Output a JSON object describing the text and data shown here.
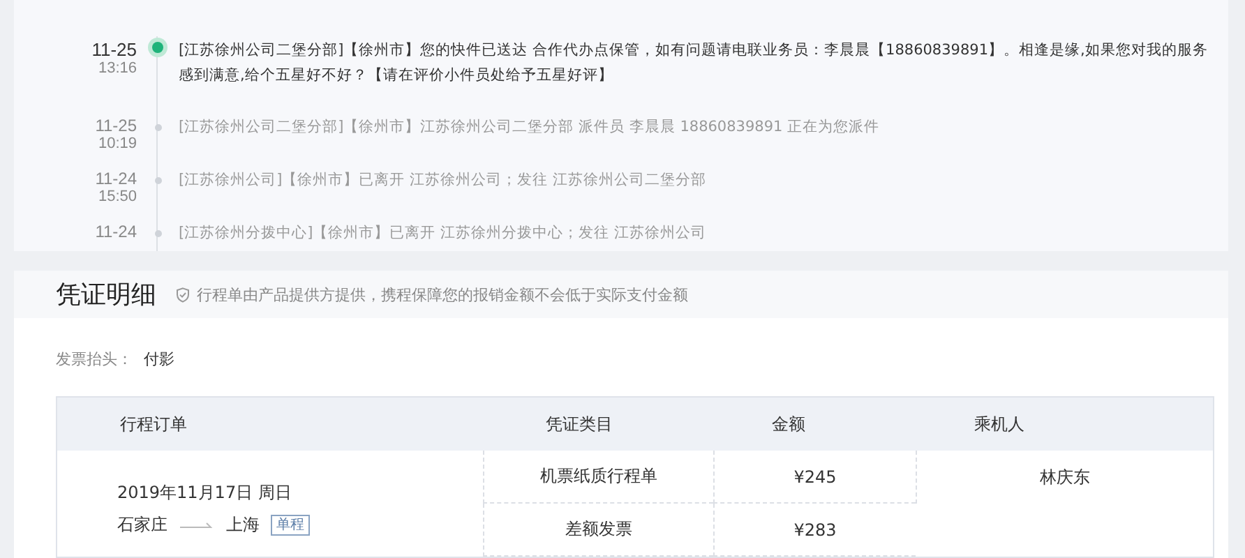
{
  "tracking": [
    {
      "date": "11-25",
      "time": "13:16",
      "text": "[江苏徐州公司二堡分部]【徐州市】您的快件已送达 合作代办点保管，如有问题请电联业务员：李晨晨【18860839891】。相逢是缘,如果您对我的服务感到满意,给个五星好不好？【请在评价小件员处给予五星好评】",
      "selected": true
    },
    {
      "date": "11-25",
      "time": "10:19",
      "text": "[江苏徐州公司二堡分部]【徐州市】江苏徐州公司二堡分部 派件员 李晨晨 18860839891 正在为您派件",
      "selected": false
    },
    {
      "date": "11-24",
      "time": "15:50",
      "text": "[江苏徐州公司]【徐州市】已离开 江苏徐州公司；发往 江苏徐州公司二堡分部",
      "selected": false
    },
    {
      "date": "11-24",
      "text": "[江苏徐州分拨中心]【徐州市】已离开 江苏徐州分拨中心；发往 江苏徐州公司",
      "selected": false
    }
  ],
  "voucher": {
    "title": "凭证明细",
    "notice": "行程单由产品提供方提供，携程保障您的报销金额不会低于实际支付金额",
    "invoice_label": "发票抬头：",
    "invoice_value": "付影"
  },
  "table": {
    "columns": [
      "行程订单",
      "凭证类目",
      "金额",
      "乘机人"
    ],
    "order": {
      "date": "2019年11月17日 周日",
      "from": "石家庄",
      "to": "上海",
      "trip_type": "单程"
    },
    "items": [
      {
        "category": "机票纸质行程单",
        "amount": "¥245"
      },
      {
        "category": "差额发票",
        "amount": "¥283"
      }
    ],
    "passenger": "林庆东"
  }
}
